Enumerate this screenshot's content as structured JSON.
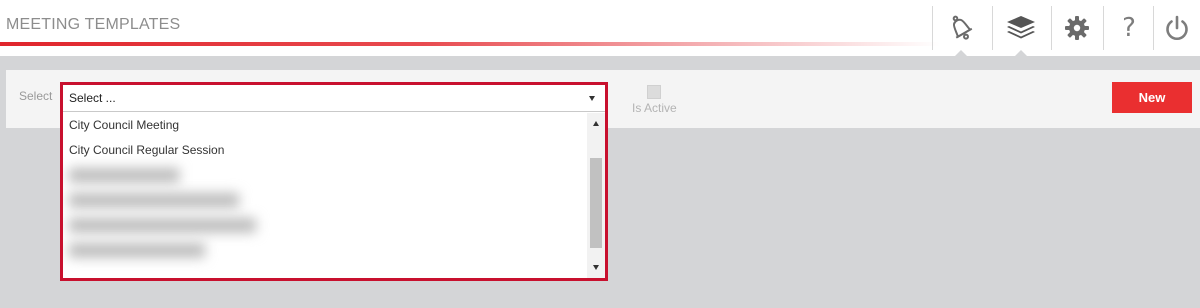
{
  "header": {
    "title": "MEETING TEMPLATES",
    "accent_color": "#e0252c",
    "tools": [
      {
        "icon": "bell-icon"
      },
      {
        "icon": "layers-icon"
      },
      {
        "icon": "gear-icon"
      },
      {
        "icon": "question-icon",
        "glyph": "?"
      },
      {
        "icon": "power-icon"
      }
    ]
  },
  "filter": {
    "select_label": "Select",
    "select_value": "Select ...",
    "options": [
      "City Council Meeting",
      "City Council Regular Session"
    ],
    "is_active_label": "Is Active",
    "new_button_label": "New",
    "new_button_color": "#ea2f30",
    "highlight_color": "#c8102e"
  }
}
